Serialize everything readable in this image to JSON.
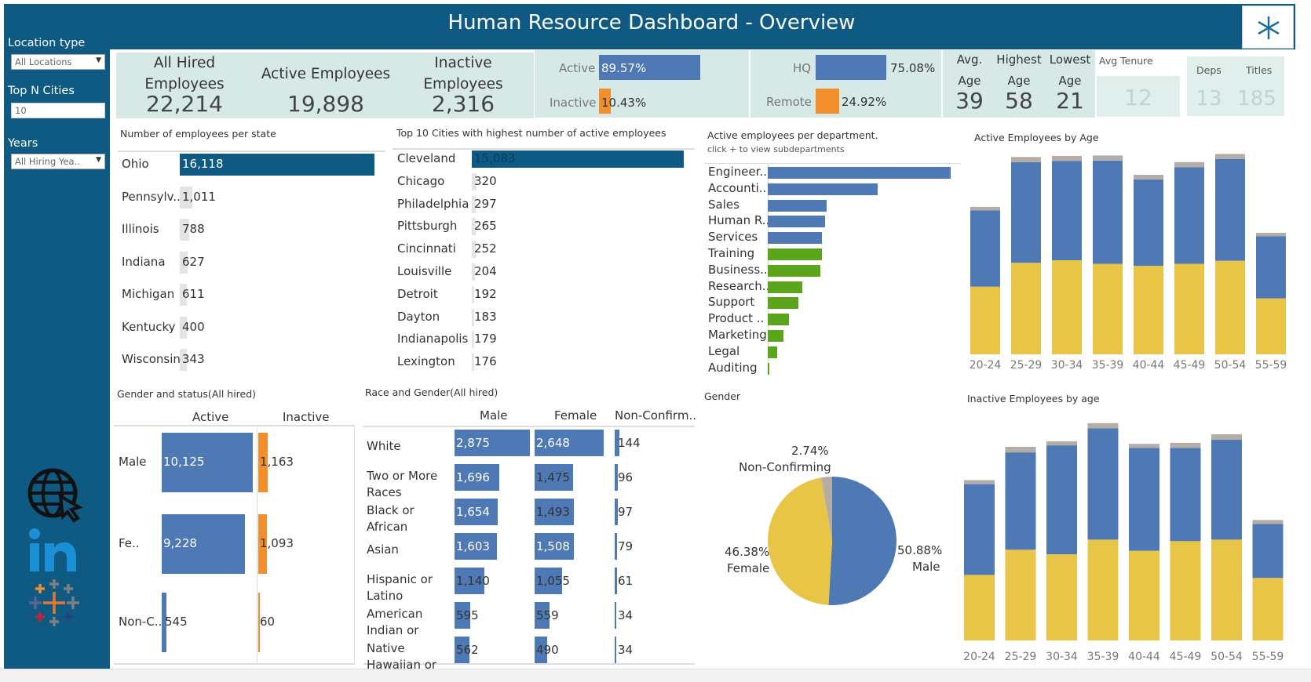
{
  "sidebar": {
    "location_type_label": "Location type",
    "location_type_value": "All Locations",
    "top_n_label": "Top N Cities",
    "top_n_value": "10",
    "years_label": "Years",
    "years_value": "All Hiring Yea.."
  },
  "header": {
    "title": "Human Resource Dashboard - Overview"
  },
  "kpis": {
    "all_hired_title": "All Hired Employees",
    "all_hired_value": "22,214",
    "active_title": "Active Employees",
    "active_value": "19,898",
    "inactive_title": "Inactive Employees",
    "inactive_value": "2,316",
    "status": {
      "active_label": "Active",
      "active_value": "89.57%",
      "active_pct": 89.57,
      "inactive_label": "Inactive",
      "inactive_value": "10.43%",
      "inactive_pct": 10.43
    },
    "location": {
      "hq_label": "HQ",
      "hq_value": "75.08%",
      "hq_pct": 75.08,
      "remote_label": "Remote",
      "remote_value": "24.92%",
      "remote_pct": 24.92
    },
    "ages": {
      "avg_label": "Avg. Age",
      "avg_value": "39",
      "high_label": "Highest Age",
      "high_value": "58",
      "low_label": "Lowest Age",
      "low_value": "21"
    },
    "tenure": {
      "label": "Avg Tenure",
      "value": "12"
    },
    "deps": {
      "label": "Deps",
      "value": "13"
    },
    "titles": {
      "label": "Titles",
      "value": "185"
    }
  },
  "states": {
    "title": "Number of employees per state",
    "max": 16118,
    "rows": [
      {
        "name": "Ohio",
        "value": 16118,
        "label": "16,118"
      },
      {
        "name": "Pennsylv..",
        "value": 1011,
        "label": "1,011"
      },
      {
        "name": "Illinois",
        "value": 788,
        "label": "788"
      },
      {
        "name": "Indiana",
        "value": 627,
        "label": "627"
      },
      {
        "name": "Michigan",
        "value": 611,
        "label": "611"
      },
      {
        "name": "Kentucky",
        "value": 400,
        "label": "400"
      },
      {
        "name": "Wisconsin",
        "value": 343,
        "label": "343"
      }
    ]
  },
  "cities": {
    "title": "Top 10 Cities with highest number of active employees",
    "max": 15083,
    "rows": [
      {
        "name": "Cleveland",
        "value": 15083,
        "label": "15,083"
      },
      {
        "name": "Chicago",
        "value": 320,
        "label": "320"
      },
      {
        "name": "Philadelphia",
        "value": 297,
        "label": "297"
      },
      {
        "name": "Pittsburgh",
        "value": 265,
        "label": "265"
      },
      {
        "name": "Cincinnati",
        "value": 252,
        "label": "252"
      },
      {
        "name": "Louisville",
        "value": 204,
        "label": "204"
      },
      {
        "name": "Detroit",
        "value": 192,
        "label": "192"
      },
      {
        "name": "Dayton",
        "value": 183,
        "label": "183"
      },
      {
        "name": "Indianapolis",
        "value": 179,
        "label": "179"
      },
      {
        "name": "Lexington",
        "value": 176,
        "label": "176"
      }
    ]
  },
  "departments": {
    "title": "Active employees per department.",
    "subtitle": "click + to view subdepartments",
    "colors": {
      "blue": "#4e79b5",
      "green": "#5aa519"
    },
    "max": 2800,
    "rows": [
      {
        "name": "Engineer..",
        "value": 2800,
        "color": "blue"
      },
      {
        "name": "Accounti..",
        "value": 1680,
        "color": "blue"
      },
      {
        "name": "Sales",
        "value": 900,
        "color": "blue"
      },
      {
        "name": "Human R..",
        "value": 880,
        "color": "blue"
      },
      {
        "name": "Services",
        "value": 830,
        "color": "blue"
      },
      {
        "name": "Training",
        "value": 830,
        "color": "green"
      },
      {
        "name": "Business..",
        "value": 810,
        "color": "green"
      },
      {
        "name": "Research..",
        "value": 530,
        "color": "green"
      },
      {
        "name": "Support",
        "value": 470,
        "color": "green"
      },
      {
        "name": "Product ..",
        "value": 320,
        "color": "green"
      },
      {
        "name": "Marketing",
        "value": 240,
        "color": "green"
      },
      {
        "name": "Legal",
        "value": 150,
        "color": "green"
      },
      {
        "name": "Auditing",
        "value": 30,
        "color": "green"
      }
    ]
  },
  "active_by_age": {
    "title": "Active Employees by Age",
    "categories": [
      "20-24",
      "25-29",
      "30-34",
      "35-39",
      "40-44",
      "45-49",
      "50-54",
      "55-59"
    ],
    "colors": {
      "female": "#e8c547",
      "male": "#4e79b5",
      "nonconf": "#b3ada6"
    },
    "series": {
      "female": [
        1330,
        1800,
        1850,
        1780,
        1740,
        1780,
        1840,
        1100
      ],
      "male": [
        1500,
        1980,
        1950,
        2030,
        1700,
        1900,
        2000,
        1220
      ],
      "nonconf": [
        70,
        100,
        100,
        100,
        90,
        100,
        100,
        70
      ]
    },
    "max": 3900
  },
  "inactive_by_age": {
    "title": "Inactive Employees by age",
    "categories": [
      "20-24",
      "25-29",
      "30-34",
      "35-39",
      "40-44",
      "45-49",
      "50-54",
      "55-59"
    ],
    "series": {
      "female": [
        130,
        180,
        171,
        200,
        178,
        197,
        200,
        124
      ],
      "male": [
        180,
        193,
        216,
        221,
        204,
        185,
        198,
        107
      ],
      "nonconf": [
        8,
        11,
        8,
        10,
        8,
        10,
        11,
        8
      ]
    },
    "max": 440
  },
  "gender_status": {
    "title": "Gender and status(All hired)",
    "active_header": "Active",
    "inactive_header": "Inactive",
    "max": 10125,
    "inactive_max": 1163,
    "rows": [
      {
        "name": "Male",
        "active": 10125,
        "active_label": "10,125",
        "inactive": 1163,
        "inactive_label": "1,163"
      },
      {
        "name": "Fe..",
        "active": 9228,
        "active_label": "9,228",
        "inactive": 1093,
        "inactive_label": "1,093"
      },
      {
        "name": "Non-C..",
        "active": 545,
        "active_label": "545",
        "inactive": 60,
        "inactive_label": "60"
      }
    ]
  },
  "race_gender": {
    "title": "Race and Gender(All hired)",
    "headers": [
      "Male",
      "Female",
      "Non-Confirm.."
    ],
    "max": 2875,
    "nc_max": 144,
    "rows": [
      {
        "name": "White",
        "male": 2875,
        "male_label": "2,875",
        "female": 2648,
        "female_label": "2,648",
        "nc": 144,
        "nc_label": "144"
      },
      {
        "name": "Two or More Races",
        "male": 1696,
        "male_label": "1,696",
        "female": 1475,
        "female_label": "1,475",
        "nc": 96,
        "nc_label": "96"
      },
      {
        "name": "Black or African Ameri..",
        "male": 1654,
        "male_label": "1,654",
        "female": 1493,
        "female_label": "1,493",
        "nc": 97,
        "nc_label": "97"
      },
      {
        "name": "Asian",
        "male": 1603,
        "male_label": "1,603",
        "female": 1508,
        "female_label": "1,508",
        "nc": 79,
        "nc_label": "79"
      },
      {
        "name": "Hispanic or Latino",
        "male": 1140,
        "male_label": "1,140",
        "female": 1055,
        "female_label": "1,055",
        "nc": 61,
        "nc_label": "61"
      },
      {
        "name": "American Indian or Alas..",
        "male": 595,
        "male_label": "595",
        "female": 559,
        "female_label": "559",
        "nc": 34,
        "nc_label": "34"
      },
      {
        "name": "Native Hawaiian or O..",
        "male": 562,
        "male_label": "562",
        "female": 490,
        "female_label": "490",
        "nc": 34,
        "nc_label": "34"
      }
    ]
  },
  "gender_pie": {
    "title": "Gender",
    "slices": [
      {
        "name": "Male",
        "value": 50.88,
        "label": "50.88%",
        "color": "#4e79b5"
      },
      {
        "name": "Female",
        "value": 46.38,
        "label": "46.38%",
        "color": "#e8c547"
      },
      {
        "name": "Non-Confirming",
        "value": 2.74,
        "label": "2.74%",
        "color": "#b3ada6"
      }
    ]
  },
  "chart_data": [
    {
      "type": "bar",
      "title": "Number of employees per state",
      "categories": [
        "Ohio",
        "Pennsylv..",
        "Illinois",
        "Indiana",
        "Michigan",
        "Kentucky",
        "Wisconsin"
      ],
      "values": [
        16118,
        1011,
        788,
        627,
        611,
        400,
        343
      ]
    },
    {
      "type": "bar",
      "title": "Top 10 Cities with highest number of active employees",
      "categories": [
        "Cleveland",
        "Chicago",
        "Philadelphia",
        "Pittsburgh",
        "Cincinnati",
        "Louisville",
        "Detroit",
        "Dayton",
        "Indianapolis",
        "Lexington"
      ],
      "values": [
        15083,
        320,
        297,
        265,
        252,
        204,
        192,
        183,
        179,
        176
      ]
    },
    {
      "type": "bar",
      "title": "Active employees per department.",
      "categories": [
        "Engineer..",
        "Accounti..",
        "Sales",
        "Human R..",
        "Services",
        "Training",
        "Business..",
        "Research..",
        "Support",
        "Product ..",
        "Marketing",
        "Legal",
        "Auditing"
      ],
      "values": [
        2800,
        1680,
        900,
        880,
        830,
        830,
        810,
        530,
        470,
        320,
        240,
        150,
        30
      ]
    },
    {
      "type": "bar",
      "title": "Active Employees by Age",
      "categories": [
        "20-24",
        "25-29",
        "30-34",
        "35-39",
        "40-44",
        "45-49",
        "50-54",
        "55-59"
      ],
      "series": [
        {
          "values": [
            1330,
            1800,
            1850,
            1780,
            1740,
            1780,
            1840,
            1100
          ]
        },
        {
          "values": [
            1500,
            1980,
            1950,
            2030,
            1700,
            1900,
            2000,
            1220
          ]
        },
        {
          "values": [
            70,
            100,
            100,
            100,
            90,
            100,
            100,
            70
          ]
        }
      ]
    },
    {
      "type": "bar",
      "title": "Inactive Employees by age",
      "categories": [
        "20-24",
        "25-29",
        "30-34",
        "35-39",
        "40-44",
        "45-49",
        "50-54",
        "55-59"
      ],
      "series": [
        {
          "values": [
            130,
            180,
            171,
            200,
            178,
            197,
            200,
            124
          ]
        },
        {
          "values": [
            180,
            193,
            216,
            221,
            204,
            185,
            198,
            107
          ]
        },
        {
          "values": [
            8,
            11,
            8,
            10,
            8,
            10,
            11,
            8
          ]
        }
      ]
    },
    {
      "type": "pie",
      "title": "Gender",
      "categories": [
        "Male",
        "Female",
        "Non-Confirming"
      ],
      "values": [
        50.88,
        46.38,
        2.74
      ]
    }
  ]
}
